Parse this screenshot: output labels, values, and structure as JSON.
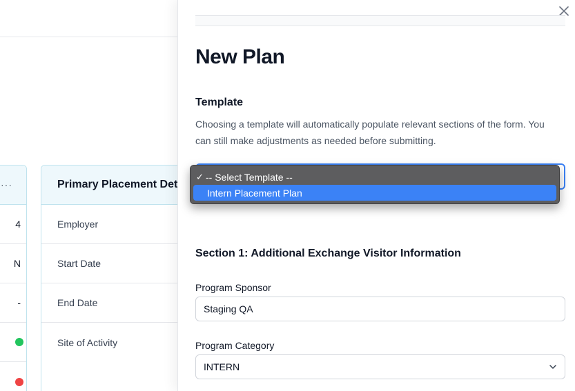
{
  "background": {
    "card_main_title": "Primary Placement Det",
    "card_left_values": [
      "4",
      "N",
      "-",
      "",
      ""
    ],
    "card_left_dots": [
      "",
      "",
      "",
      "green",
      "red"
    ],
    "card_main_rows": [
      "Employer",
      "Start Date",
      "End Date",
      "Site of Activity"
    ],
    "more_icon": "···"
  },
  "drawer": {
    "title": "New Plan",
    "template_heading": "Template",
    "template_description": "Choosing a template will automatically populate relevant sections of the form. You can still make adjustments as needed before submitting.",
    "template_select": {
      "options": [
        {
          "label": "-- Select Template --",
          "checked": true,
          "highlighted": false
        },
        {
          "label": "Intern Placement Plan",
          "checked": false,
          "highlighted": true
        }
      ],
      "check_mark": "✓"
    },
    "section1_heading": "Section 1: Additional Exchange Visitor Information",
    "program_sponsor_label": "Program Sponsor",
    "program_sponsor_value": "Staging QA",
    "program_category_label": "Program Category",
    "program_category_value": "INTERN"
  },
  "colors": {
    "accent": "#3b82f6",
    "card_border": "#bfe3ee",
    "card_header_bg": "#eef8fc",
    "dropdown_bg": "#5d5d5f",
    "status_green": "#22c55e",
    "status_red": "#ef4444"
  }
}
